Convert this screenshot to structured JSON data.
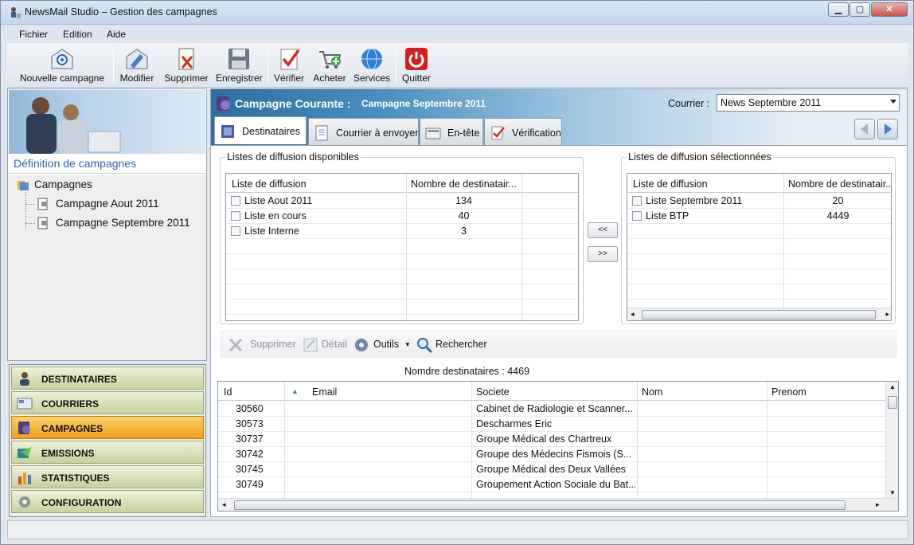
{
  "window": {
    "title": "NewsMail Studio – Gestion des campagnes"
  },
  "menu": [
    "Fichier",
    "Edition",
    "Aide"
  ],
  "toolbar": [
    {
      "label": "Nouvelle campagne",
      "icon": "envelope-at-icon"
    },
    {
      "label": "Modifier",
      "icon": "edit-envelope-icon"
    },
    {
      "label": "Supprimer",
      "icon": "delete-document-icon"
    },
    {
      "label": "Enregistrer",
      "icon": "floppy-disk-icon"
    },
    {
      "label": "Vérifier",
      "icon": "checklist-icon"
    },
    {
      "label": "Acheter",
      "icon": "shopping-cart-icon"
    },
    {
      "label": "Services",
      "icon": "globe-icon"
    },
    {
      "label": "Quitter",
      "icon": "power-icon"
    }
  ],
  "sidebar": {
    "title": "Définition de campagnes",
    "tree_root": "Campagnes",
    "tree_items": [
      "Campagne Aout 2011",
      "Campagne Septembre 2011"
    ]
  },
  "nav": [
    {
      "label": "DESTINATAIRES",
      "icon": "users-icon",
      "active": false
    },
    {
      "label": "COURRIERS",
      "icon": "mail-icon",
      "active": false
    },
    {
      "label": "CAMPAGNES",
      "icon": "campaign-icon",
      "active": true
    },
    {
      "label": "EMISSIONS",
      "icon": "send-icon",
      "active": false
    },
    {
      "label": "STATISTIQUES",
      "icon": "bar-chart-icon",
      "active": false
    },
    {
      "label": "CONFIGURATION",
      "icon": "gear-icon",
      "active": false
    }
  ],
  "banner": {
    "title": "Campagne Courante :",
    "campaign": "Campagne Septembre 2011",
    "courrier_label": "Courrier :",
    "courrier_value": "News Septembre 2011"
  },
  "tabs": [
    {
      "label": "Destinataires",
      "selected": true
    },
    {
      "label": "Courrier à envoyer",
      "selected": false
    },
    {
      "label": "En-tête",
      "selected": false
    },
    {
      "label": "Vérification",
      "selected": false
    }
  ],
  "available": {
    "group_label": "Listes de diffusion disponibles",
    "columns": [
      "Liste de diffusion",
      "Nombre de destinatair..."
    ],
    "rows": [
      {
        "name": "Liste Aout 2011",
        "count": "134"
      },
      {
        "name": "Liste en cours",
        "count": "40"
      },
      {
        "name": "Liste Interne",
        "count": "3"
      }
    ]
  },
  "selected": {
    "group_label": "Listes de diffusion sélectionnées",
    "columns": [
      "Liste de diffusion",
      "Nombre de destinatair..."
    ],
    "rows": [
      {
        "name": "Liste Septembre 2011",
        "count": "20"
      },
      {
        "name": "Liste BTP",
        "count": "4449"
      }
    ]
  },
  "move_buttons": {
    "left": "<<",
    "right": ">>"
  },
  "actions": {
    "delete": "Supprimer",
    "detail": "Détail",
    "tools": "Outils",
    "search": "Rechercher"
  },
  "count_label": "Nomdre destinataires : 4469",
  "recipients": {
    "columns": [
      "Id",
      "Email",
      "Societe",
      "Nom",
      "Prenom"
    ],
    "rows": [
      {
        "id": "30560",
        "email": "",
        "societe": "Cabinet de Radiologie et Scanner...",
        "nom": "",
        "prenom": ""
      },
      {
        "id": "30573",
        "email": "",
        "societe": "Descharmes Eric",
        "nom": "",
        "prenom": ""
      },
      {
        "id": "30737",
        "email": "",
        "societe": "Groupe Médical des Chartreux",
        "nom": "",
        "prenom": ""
      },
      {
        "id": "30742",
        "email": "",
        "societe": "Groupe des Médecins Fismois (S...",
        "nom": "",
        "prenom": ""
      },
      {
        "id": "30745",
        "email": "",
        "societe": "Groupe Médical des Deux Vallées",
        "nom": "",
        "prenom": ""
      },
      {
        "id": "30749",
        "email": "",
        "societe": "Groupement Action Sociale du Bat...",
        "nom": "",
        "prenom": ""
      }
    ]
  }
}
